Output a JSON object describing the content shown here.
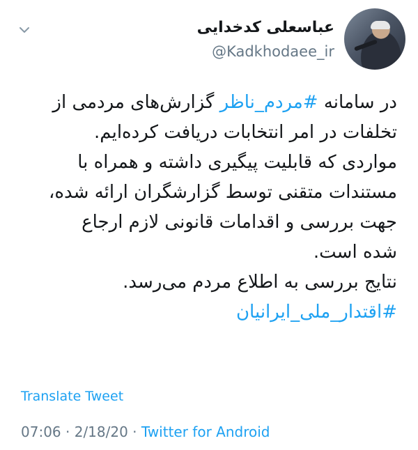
{
  "author": {
    "display_name": "عباسعلی کدخدایی",
    "handle": "@Kadkhodaee_ir"
  },
  "tweet": {
    "l1_pre": "در سامانه ",
    "l1_tag": "#مردم_ناظر",
    "l1_post": " گزارش‌های مردمی از",
    "l2": "تخلفات در امر انتخابات دریافت کرده‌ایم.",
    "l3": "مواردی که قابلیت پیگیری داشته و همراه با",
    "l4": "مستندات متقنی توسط گزارشگران ارائه شده،",
    "l5": "جهت بررسی و اقدامات قانونی لازم ارجاع",
    "l6": "شده است.",
    "l7": "نتایج بررسی به اطلاع مردم می‌رسد.",
    "l8_tag": "#اقتدار_ملی_ایرانیان"
  },
  "translate_label": "Translate Tweet",
  "meta": {
    "time": "07:06",
    "sep1": " · ",
    "date": "2/18/20",
    "sep2": " · ",
    "source": "Twitter for Android"
  },
  "colors": {
    "link": "#1da1f2",
    "text": "#14171a",
    "secondary": "#657786"
  },
  "icons": {
    "menu": "chevron-down-icon"
  }
}
